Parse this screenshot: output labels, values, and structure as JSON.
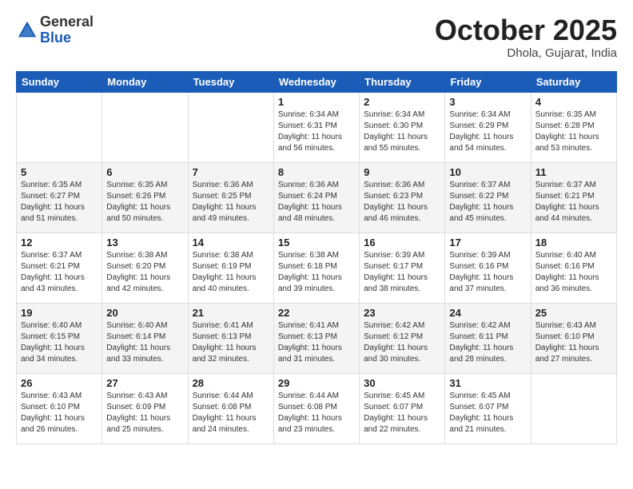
{
  "logo": {
    "general": "General",
    "blue": "Blue"
  },
  "header": {
    "month": "October 2025",
    "location": "Dhola, Gujarat, India"
  },
  "days": [
    "Sunday",
    "Monday",
    "Tuesday",
    "Wednesday",
    "Thursday",
    "Friday",
    "Saturday"
  ],
  "weeks": [
    [
      {
        "date": "",
        "info": ""
      },
      {
        "date": "",
        "info": ""
      },
      {
        "date": "",
        "info": ""
      },
      {
        "date": "1",
        "info": "Sunrise: 6:34 AM\nSunset: 6:31 PM\nDaylight: 11 hours\nand 56 minutes."
      },
      {
        "date": "2",
        "info": "Sunrise: 6:34 AM\nSunset: 6:30 PM\nDaylight: 11 hours\nand 55 minutes."
      },
      {
        "date": "3",
        "info": "Sunrise: 6:34 AM\nSunset: 6:29 PM\nDaylight: 11 hours\nand 54 minutes."
      },
      {
        "date": "4",
        "info": "Sunrise: 6:35 AM\nSunset: 6:28 PM\nDaylight: 11 hours\nand 53 minutes."
      }
    ],
    [
      {
        "date": "5",
        "info": "Sunrise: 6:35 AM\nSunset: 6:27 PM\nDaylight: 11 hours\nand 51 minutes."
      },
      {
        "date": "6",
        "info": "Sunrise: 6:35 AM\nSunset: 6:26 PM\nDaylight: 11 hours\nand 50 minutes."
      },
      {
        "date": "7",
        "info": "Sunrise: 6:36 AM\nSunset: 6:25 PM\nDaylight: 11 hours\nand 49 minutes."
      },
      {
        "date": "8",
        "info": "Sunrise: 6:36 AM\nSunset: 6:24 PM\nDaylight: 11 hours\nand 48 minutes."
      },
      {
        "date": "9",
        "info": "Sunrise: 6:36 AM\nSunset: 6:23 PM\nDaylight: 11 hours\nand 46 minutes."
      },
      {
        "date": "10",
        "info": "Sunrise: 6:37 AM\nSunset: 6:22 PM\nDaylight: 11 hours\nand 45 minutes."
      },
      {
        "date": "11",
        "info": "Sunrise: 6:37 AM\nSunset: 6:21 PM\nDaylight: 11 hours\nand 44 minutes."
      }
    ],
    [
      {
        "date": "12",
        "info": "Sunrise: 6:37 AM\nSunset: 6:21 PM\nDaylight: 11 hours\nand 43 minutes."
      },
      {
        "date": "13",
        "info": "Sunrise: 6:38 AM\nSunset: 6:20 PM\nDaylight: 11 hours\nand 42 minutes."
      },
      {
        "date": "14",
        "info": "Sunrise: 6:38 AM\nSunset: 6:19 PM\nDaylight: 11 hours\nand 40 minutes."
      },
      {
        "date": "15",
        "info": "Sunrise: 6:38 AM\nSunset: 6:18 PM\nDaylight: 11 hours\nand 39 minutes."
      },
      {
        "date": "16",
        "info": "Sunrise: 6:39 AM\nSunset: 6:17 PM\nDaylight: 11 hours\nand 38 minutes."
      },
      {
        "date": "17",
        "info": "Sunrise: 6:39 AM\nSunset: 6:16 PM\nDaylight: 11 hours\nand 37 minutes."
      },
      {
        "date": "18",
        "info": "Sunrise: 6:40 AM\nSunset: 6:16 PM\nDaylight: 11 hours\nand 36 minutes."
      }
    ],
    [
      {
        "date": "19",
        "info": "Sunrise: 6:40 AM\nSunset: 6:15 PM\nDaylight: 11 hours\nand 34 minutes."
      },
      {
        "date": "20",
        "info": "Sunrise: 6:40 AM\nSunset: 6:14 PM\nDaylight: 11 hours\nand 33 minutes."
      },
      {
        "date": "21",
        "info": "Sunrise: 6:41 AM\nSunset: 6:13 PM\nDaylight: 11 hours\nand 32 minutes."
      },
      {
        "date": "22",
        "info": "Sunrise: 6:41 AM\nSunset: 6:13 PM\nDaylight: 11 hours\nand 31 minutes."
      },
      {
        "date": "23",
        "info": "Sunrise: 6:42 AM\nSunset: 6:12 PM\nDaylight: 11 hours\nand 30 minutes."
      },
      {
        "date": "24",
        "info": "Sunrise: 6:42 AM\nSunset: 6:11 PM\nDaylight: 11 hours\nand 28 minutes."
      },
      {
        "date": "25",
        "info": "Sunrise: 6:43 AM\nSunset: 6:10 PM\nDaylight: 11 hours\nand 27 minutes."
      }
    ],
    [
      {
        "date": "26",
        "info": "Sunrise: 6:43 AM\nSunset: 6:10 PM\nDaylight: 11 hours\nand 26 minutes."
      },
      {
        "date": "27",
        "info": "Sunrise: 6:43 AM\nSunset: 6:09 PM\nDaylight: 11 hours\nand 25 minutes."
      },
      {
        "date": "28",
        "info": "Sunrise: 6:44 AM\nSunset: 6:08 PM\nDaylight: 11 hours\nand 24 minutes."
      },
      {
        "date": "29",
        "info": "Sunrise: 6:44 AM\nSunset: 6:08 PM\nDaylight: 11 hours\nand 23 minutes."
      },
      {
        "date": "30",
        "info": "Sunrise: 6:45 AM\nSunset: 6:07 PM\nDaylight: 11 hours\nand 22 minutes."
      },
      {
        "date": "31",
        "info": "Sunrise: 6:45 AM\nSunset: 6:07 PM\nDaylight: 11 hours\nand 21 minutes."
      },
      {
        "date": "",
        "info": ""
      }
    ]
  ]
}
